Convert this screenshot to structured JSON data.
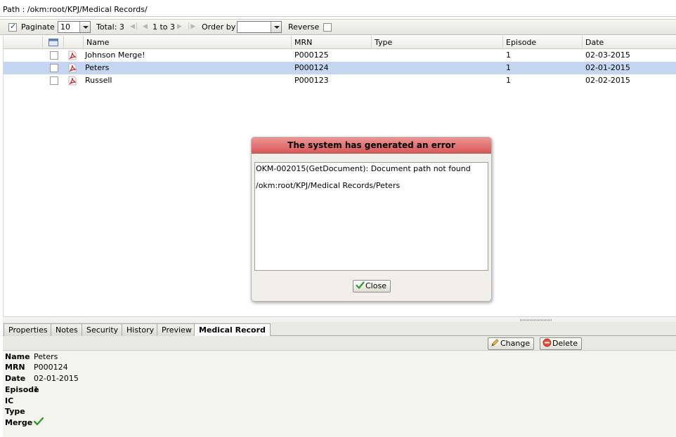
{
  "path_bar": {
    "text": "Path : /okm:root/KPJ/Medical Records/"
  },
  "toolbar": {
    "paginate_label": "Paginate",
    "page_size": "10",
    "total_label": "Total: 3",
    "range_label": "1 to 3",
    "order_by_label": "Order by",
    "order_by_value": "",
    "reverse_label": "Reverse"
  },
  "grid": {
    "columns": [
      "Name",
      "MRN",
      "Type",
      "Episode",
      "Date"
    ],
    "rows": [
      {
        "name": "Johnson Merge!",
        "mrn": "P000125",
        "type": "",
        "episode": "1",
        "date": "02-03-2015"
      },
      {
        "name": "Peters",
        "mrn": "P000124",
        "type": "",
        "episode": "1",
        "date": "02-01-2015"
      },
      {
        "name": "Russell",
        "mrn": "P000123",
        "type": "",
        "episode": "1",
        "date": "02-02-2015"
      }
    ]
  },
  "tabs": [
    "Properties",
    "Notes",
    "Security",
    "History",
    "Preview",
    "Medical Record"
  ],
  "detail_toolbar": {
    "change_label": "Change",
    "delete_label": "Delete"
  },
  "detail": {
    "name_label": "Name",
    "name_value": "Peters",
    "mrn_label": "MRN",
    "mrn_value": "P000124",
    "date_label": "Date",
    "date_value": "02-01-2015",
    "episode_label": "Episode",
    "episode_value": "1",
    "ic_label": "IC",
    "ic_value": "",
    "type_label": "Type",
    "type_value": "",
    "merge_label": "Merge"
  },
  "dialog": {
    "title": "The system has generated an error",
    "message_line1": "OKM-002015(GetDocument): Document path not found",
    "message_line2": "/okm:root/KPJ/Medical Records/Peters",
    "close_label": "Close"
  },
  "colors": {
    "selected_row": "#c4d6f2",
    "dialog_title": "#e07676",
    "pdf_icon": "#cc2222",
    "check_green": "#2e9a2e"
  },
  "icons": {
    "file_type": "pdf-icon",
    "change": "pencil-icon",
    "delete": "delete-icon",
    "close": "check-icon",
    "merge": "check-icon"
  }
}
